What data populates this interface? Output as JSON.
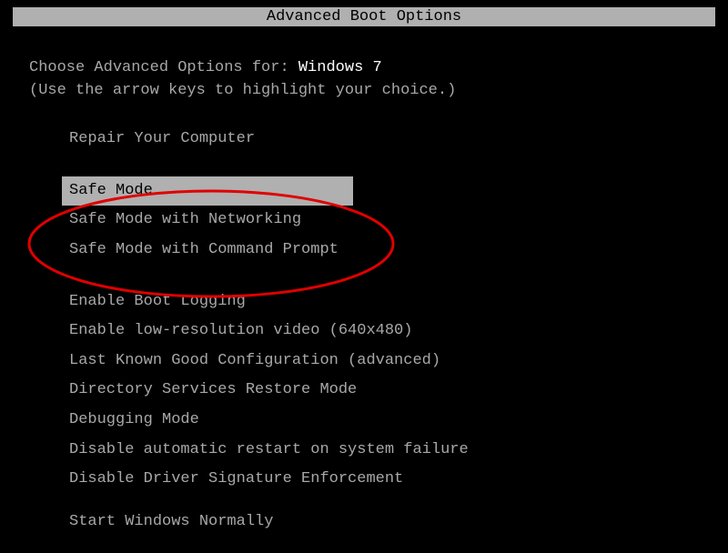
{
  "title": "Advanced Boot Options",
  "prompt_prefix": "Choose Advanced Options for: ",
  "os_name": "Windows 7",
  "instruction": "(Use the arrow keys to highlight your choice.)",
  "menu": {
    "group1": [
      {
        "label": "Repair Your Computer",
        "selected": false
      }
    ],
    "group2": [
      {
        "label": "Safe Mode",
        "selected": true
      },
      {
        "label": "Safe Mode with Networking",
        "selected": false
      },
      {
        "label": "Safe Mode with Command Prompt",
        "selected": false
      }
    ],
    "group3": [
      {
        "label": "Enable Boot Logging",
        "selected": false
      },
      {
        "label": "Enable low-resolution video (640x480)",
        "selected": false
      },
      {
        "label": "Last Known Good Configuration (advanced)",
        "selected": false
      },
      {
        "label": "Directory Services Restore Mode",
        "selected": false
      },
      {
        "label": "Debugging Mode",
        "selected": false
      },
      {
        "label": "Disable automatic restart on system failure",
        "selected": false
      },
      {
        "label": "Disable Driver Signature Enforcement",
        "selected": false
      }
    ],
    "group4": [
      {
        "label": "Start Windows Normally",
        "selected": false
      }
    ]
  },
  "annotation": {
    "color": "#e00000",
    "shape": "ellipse"
  }
}
